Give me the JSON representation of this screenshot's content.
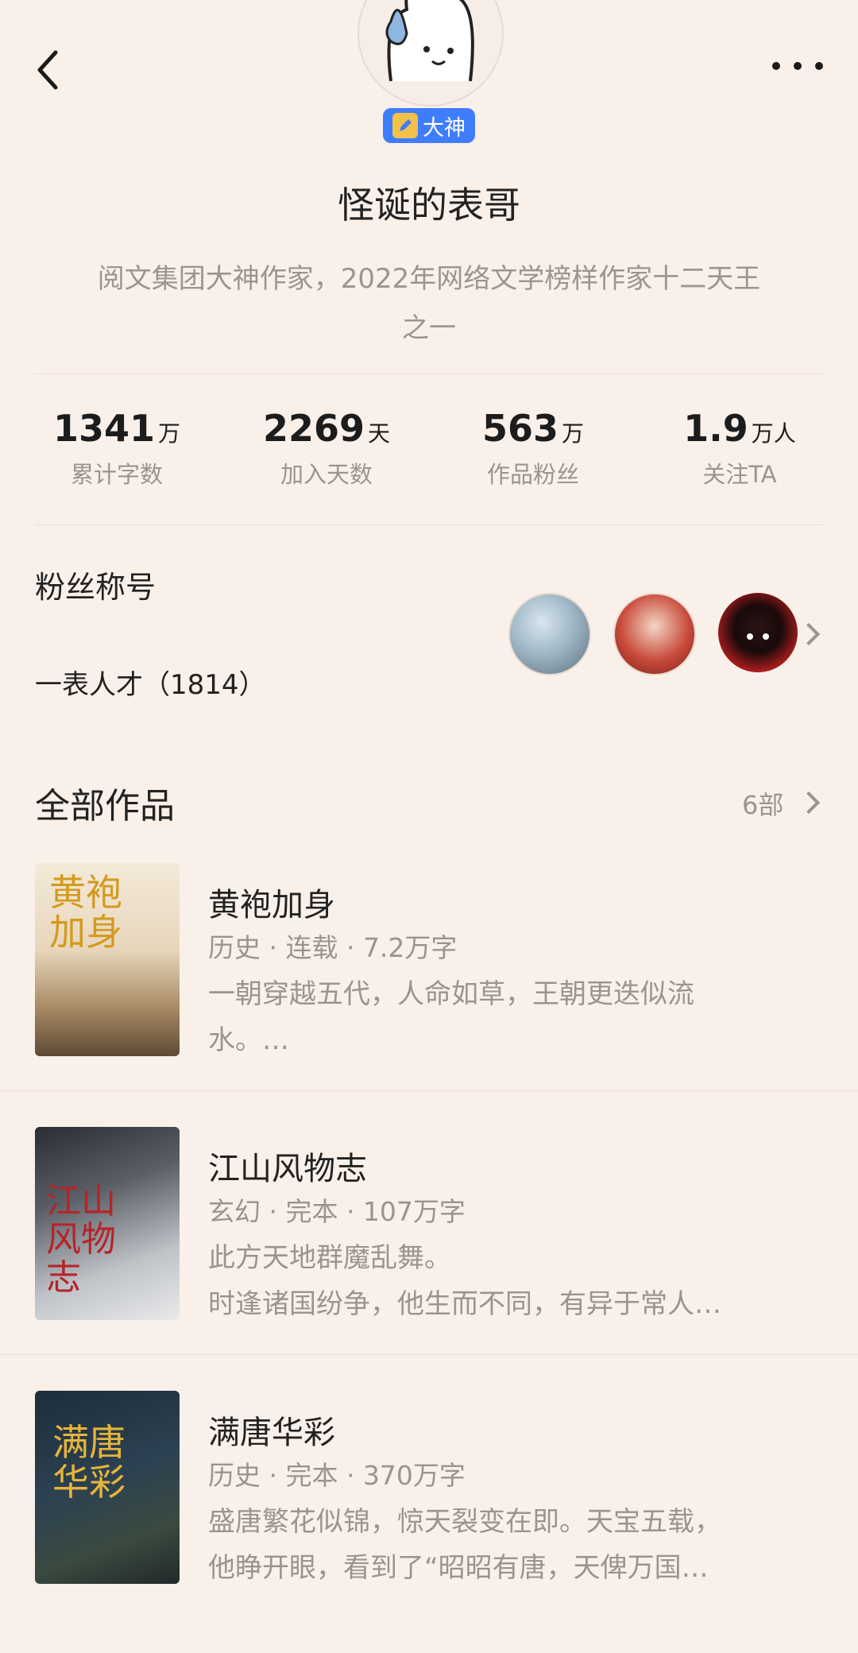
{
  "header": {
    "back_icon": "back-arrow-icon",
    "more_icon": "more-dots-icon"
  },
  "author": {
    "badge_label": "大神",
    "name": "怪诞的表哥",
    "bio_line1": "阅文集团大神作家，2022年网络文学榜样作家十二天王",
    "bio_line2": "之一"
  },
  "stats": [
    {
      "value": "1341",
      "unit": "万",
      "label": "累计字数"
    },
    {
      "value": "2269",
      "unit": "天",
      "label": "加入天数"
    },
    {
      "value": "563",
      "unit": "万",
      "label": "作品粉丝"
    },
    {
      "value": "1.9",
      "unit": "万人",
      "label": "关注TA"
    }
  ],
  "fans": {
    "title": "粉丝称号",
    "value": "一表人才（1814）"
  },
  "works": {
    "title": "全部作品",
    "count": "6部",
    "books": [
      {
        "title": "黄袍加身",
        "meta": "历史 · 连载 · 7.2万字",
        "desc1": "一朝穿越五代，人命如草，王朝更迭似流",
        "desc2": "水。…",
        "cover_text": "黄袍加身"
      },
      {
        "title": "江山风物志",
        "meta": "玄幻 · 完本 · 107万字",
        "desc1": "此方天地群魔乱舞。",
        "desc2": "时逢诸国纷争，他生而不同，有异于常人…",
        "cover_text": "江山风物志"
      },
      {
        "title": "满唐华彩",
        "meta": "历史 · 完本 · 370万字",
        "desc1": "盛唐繁花似锦，惊天裂变在即。天宝五载，",
        "desc2": "他睁开眼，看到了“昭昭有唐，天俾万国…",
        "cover_text": "满唐华彩"
      }
    ]
  },
  "colors": {
    "background": "#faf0ea",
    "badge": "#3f7dff",
    "muted": "#9a948f"
  }
}
